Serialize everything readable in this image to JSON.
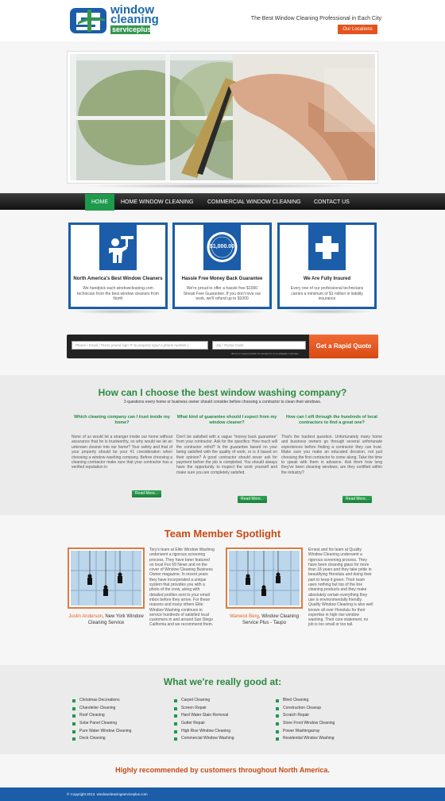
{
  "header": {
    "logo_line1": "window",
    "logo_line2": "cleaning",
    "logo_line3": "serviceplus",
    "tagline": "The Best Window Cleaning Professional in Each City",
    "locations_button": "Our Locations"
  },
  "nav": {
    "items": [
      "HOME",
      "HOME WINDOW CLEANING",
      "COMMERCIAL WINDOW CLEANING",
      "CONTACT US"
    ]
  },
  "features": [
    {
      "icon": "window-cleaner-icon",
      "title": "North America's Best Window Cleaners",
      "text": "We handpick each windowcleaning.com technician from the best window cleaners from North"
    },
    {
      "icon": "money-seal-icon",
      "badge": "$1,000.00",
      "title": "Hassle Free Money Back Guarantee",
      "text": "We're proud to offer a hassle free $1000 Streak Free Guarantee. If you don't love our work, we'll refund up to $1000"
    },
    {
      "icon": "medical-cross-icon",
      "title": "We Are Fully Insured",
      "text": "Every one of our professional technicians carries a minimum of $1 million in liability insurance"
    }
  ],
  "quote": {
    "phone_placeholder": "Phone / Email ( Press pound sign '#' to properly input a phone number )",
    "zip_placeholder": "Zip / Postal Code",
    "note": "We try to respond within 10 minutes for a no-obligation estimate",
    "button": "Get a Rapid Quote"
  },
  "choose": {
    "heading": "How can I choose the best window washing company?",
    "subheading": "3 questions every home or business owner should consider before choosing a contractor to clean their windows.",
    "columns": [
      {
        "question": "Which cleaning company can I trust inside my home?",
        "text": "None of us would let a stranger inside our home without assurance that he is trustworthy, so why would we let an unknown cleaner into our home? Your safety and that of your property should be your #1 consideration when choosing a window washing company. Before choosing a cleaning contractor make sure that your contractor has a verified reputation in",
        "more": "Read More..."
      },
      {
        "question": "What kind of guarantee should I expect from my window cleaner?",
        "text": "Don't be satisfied with a vague \"money back guarantee\" from your contractor. Ask for the specifics: How much will the contractor refnd? Is the guarantee based on your being satisfied with the quality of work, or is it based on their opinion? A good contractor should never ask for payment before the job is completed. You should always have the opportunity to inspect the work yourself and make sure you are completely satisfed.",
        "more": "Read More..."
      },
      {
        "question": "How can I sift through the hundreds of local contractors to find a great one?",
        "text": "That's the hardest question. Unfortunately many home and business owners go through several unfortunate experiences before finding a contractor they can trust. Make sure you make an educated decision, not just choosing the first contractor to come along. Take the time to speak with them in advance. Ask them how long they've been cleaning windows, are they certified within the industry?",
        "more": "Read More..."
      }
    ]
  },
  "team": {
    "heading": "Team Member Spotlight",
    "members": [
      {
        "name": "Justin Anderson",
        "company": ", New York Window Cleaning Service",
        "text": "Tory's team at Elite Window Washing underwent a rigorous screening process. They have been featured on local Fox 69 News and on the cover of Window Cleaning Business Owner magazine. In recent years they have incorporated a unique system that provides you with a photo of the crew, along with detailed profiles sent to your email inbox before they arrive. For these reasons and many others Elite Window Washing continues to service hundreds of satisfied local customers in and around San Diego California and we recommend them."
      },
      {
        "name": "Warwick Berg",
        "company": ", Window Cleaning Service Plus - Taupo",
        "text": "Ernest and his team at Quality Window Cleaning underwent a rigorous screening process. They have been cleaning glass for more than 18 years and they take pride in beautifying Honolulu and doing their part to keep it green. Their team uses nothing but top of the line cleaning products and they make absolutely certain everything they use is environmentally friendly. Quality Window Cleaning is also well known all over Honolulu for their expertise in high rise window washing. Their core statement, no job is too small or too tall."
      }
    ]
  },
  "services": {
    "heading": "What we're really good at:",
    "columns": [
      [
        "Christmas Decorations",
        "Chandelier Cleaning",
        "Roof Cleaning",
        "Solar Panel Cleaning",
        "Pure Water Window Cleaning",
        "Deck Cleaning"
      ],
      [
        "Carpet Cleaning",
        "Screen Repair",
        "Hard Water Stain Removal",
        "Gutter Repair",
        "High Rise Window Cleaning",
        "Commercial Window Washing"
      ],
      [
        "Blind Cleaning",
        "Construction Cleanup",
        "Scratch Repair",
        "Store Front Window Cleaning",
        "Power Washingarray",
        "Residential Window Washing"
      ]
    ]
  },
  "recommend": "Highly recommended by customers throughout North America.",
  "footer": "© Copyright 2013. windowcleaningserviceplus.com",
  "colors": {
    "green": "#1e9a4c",
    "blue": "#1b5da8",
    "orange": "#e6531d"
  }
}
